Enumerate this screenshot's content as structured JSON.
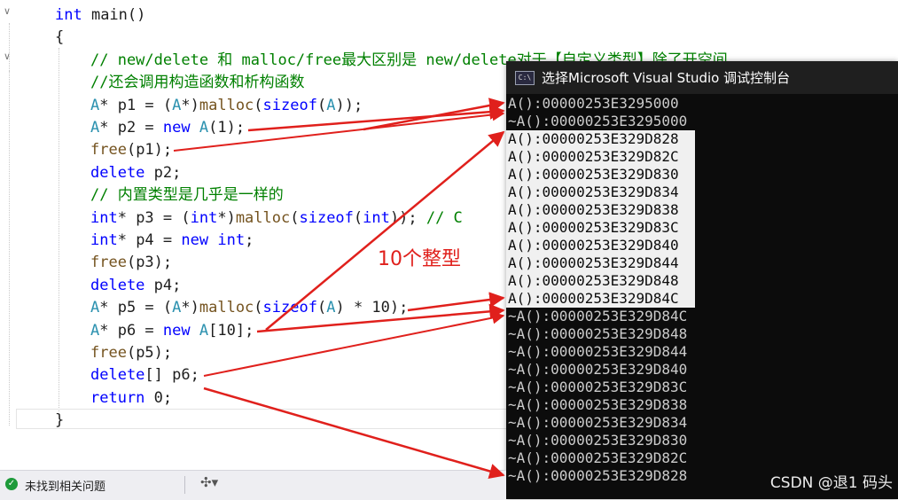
{
  "editor": {
    "lines": [
      [
        {
          "t": "int",
          "c": "kw"
        },
        {
          "t": " main()"
        }
      ],
      [
        {
          "t": "{"
        }
      ],
      [
        {
          "t": "// new/delete 和 malloc/free最大区别是 new/delete对于【自定义类型】除了开空间",
          "c": "cm"
        }
      ],
      [
        {
          "t": "//还会调用构造函数和析构函数",
          "c": "cm"
        }
      ],
      [
        {
          "t": "A",
          "c": "ty"
        },
        {
          "t": "* p1 = ("
        },
        {
          "t": "A",
          "c": "ty"
        },
        {
          "t": "*)"
        },
        {
          "t": "malloc",
          "c": "fn"
        },
        {
          "t": "("
        },
        {
          "t": "sizeof",
          "c": "kw"
        },
        {
          "t": "("
        },
        {
          "t": "A",
          "c": "ty"
        },
        {
          "t": "));"
        }
      ],
      [
        {
          "t": "A",
          "c": "ty"
        },
        {
          "t": "* p2 = "
        },
        {
          "t": "new",
          "c": "kw"
        },
        {
          "t": " "
        },
        {
          "t": "A",
          "c": "ty"
        },
        {
          "t": "(1);"
        }
      ],
      [
        {
          "t": "free",
          "c": "fn"
        },
        {
          "t": "(p1);"
        }
      ],
      [
        {
          "t": "delete",
          "c": "kw"
        },
        {
          "t": " p2;"
        }
      ],
      [
        {
          "t": "// 内置类型是几乎是一样的",
          "c": "cm"
        }
      ],
      [
        {
          "t": "int",
          "c": "kw"
        },
        {
          "t": "* p3 = ("
        },
        {
          "t": "int",
          "c": "kw"
        },
        {
          "t": "*)"
        },
        {
          "t": "malloc",
          "c": "fn"
        },
        {
          "t": "("
        },
        {
          "t": "sizeof",
          "c": "kw"
        },
        {
          "t": "("
        },
        {
          "t": "int",
          "c": "kw"
        },
        {
          "t": ")); "
        },
        {
          "t": "// C",
          "c": "cm"
        }
      ],
      [
        {
          "t": "int",
          "c": "kw"
        },
        {
          "t": "* p4 = "
        },
        {
          "t": "new",
          "c": "kw"
        },
        {
          "t": " "
        },
        {
          "t": "int",
          "c": "kw"
        },
        {
          "t": ";"
        }
      ],
      [
        {
          "t": "free",
          "c": "fn"
        },
        {
          "t": "(p3);"
        }
      ],
      [
        {
          "t": "delete",
          "c": "kw"
        },
        {
          "t": " p4;"
        }
      ],
      [
        {
          "t": "A",
          "c": "ty"
        },
        {
          "t": "* p5 = ("
        },
        {
          "t": "A",
          "c": "ty"
        },
        {
          "t": "*)"
        },
        {
          "t": "malloc",
          "c": "fn"
        },
        {
          "t": "("
        },
        {
          "t": "sizeof",
          "c": "kw"
        },
        {
          "t": "("
        },
        {
          "t": "A",
          "c": "ty"
        },
        {
          "t": ") * 10);"
        }
      ],
      [
        {
          "t": "A",
          "c": "ty"
        },
        {
          "t": "* p6 = "
        },
        {
          "t": "new",
          "c": "kw"
        },
        {
          "t": " "
        },
        {
          "t": "A",
          "c": "ty"
        },
        {
          "t": "[10];"
        }
      ],
      [
        {
          "t": "free",
          "c": "fn"
        },
        {
          "t": "(p5);"
        }
      ],
      [
        {
          "t": "delete",
          "c": "kw"
        },
        {
          "t": "[] p6;"
        }
      ],
      [
        {
          "t": "return",
          "c": "kw"
        },
        {
          "t": " 0;"
        }
      ],
      [
        {
          "t": "}"
        }
      ]
    ]
  },
  "annotation": "10个整型",
  "console": {
    "title": "选择Microsoft Visual Studio 调试控制台",
    "icon": "console-app-icon",
    "lines": [
      {
        "text": "A():00000253E3295000",
        "selected": false
      },
      {
        "text": "~A():00000253E3295000",
        "selected": false
      },
      {
        "text": "A():00000253E329D828",
        "selected": true
      },
      {
        "text": "A():00000253E329D82C",
        "selected": true
      },
      {
        "text": "A():00000253E329D830",
        "selected": true
      },
      {
        "text": "A():00000253E329D834",
        "selected": true
      },
      {
        "text": "A():00000253E329D838",
        "selected": true
      },
      {
        "text": "A():00000253E329D83C",
        "selected": true
      },
      {
        "text": "A():00000253E329D840",
        "selected": true
      },
      {
        "text": "A():00000253E329D844",
        "selected": true
      },
      {
        "text": "A():00000253E329D848",
        "selected": true
      },
      {
        "text": "A():00000253E329D84C",
        "selected": true
      },
      {
        "text": "~A():00000253E329D84C",
        "selected": false
      },
      {
        "text": "~A():00000253E329D848",
        "selected": false
      },
      {
        "text": "~A():00000253E329D844",
        "selected": false
      },
      {
        "text": "~A():00000253E329D840",
        "selected": false
      },
      {
        "text": "~A():00000253E329D83C",
        "selected": false
      },
      {
        "text": "~A():00000253E329D838",
        "selected": false
      },
      {
        "text": "~A():00000253E329D834",
        "selected": false
      },
      {
        "text": "~A():00000253E329D830",
        "selected": false
      },
      {
        "text": "~A():00000253E329D82C",
        "selected": false
      },
      {
        "text": "~A():00000253E329D828",
        "selected": false
      }
    ],
    "watermark": "CSDN @退1  码头"
  },
  "statusbar": {
    "status_text": "未找到相关问题",
    "status_icon": "check-circle-icon",
    "cleanup_icon": "broom-icon"
  },
  "colors": {
    "keyword": "#0000ff",
    "type": "#2b91af",
    "function": "#74531f",
    "comment": "#008000",
    "arrow": "#e0201c"
  }
}
